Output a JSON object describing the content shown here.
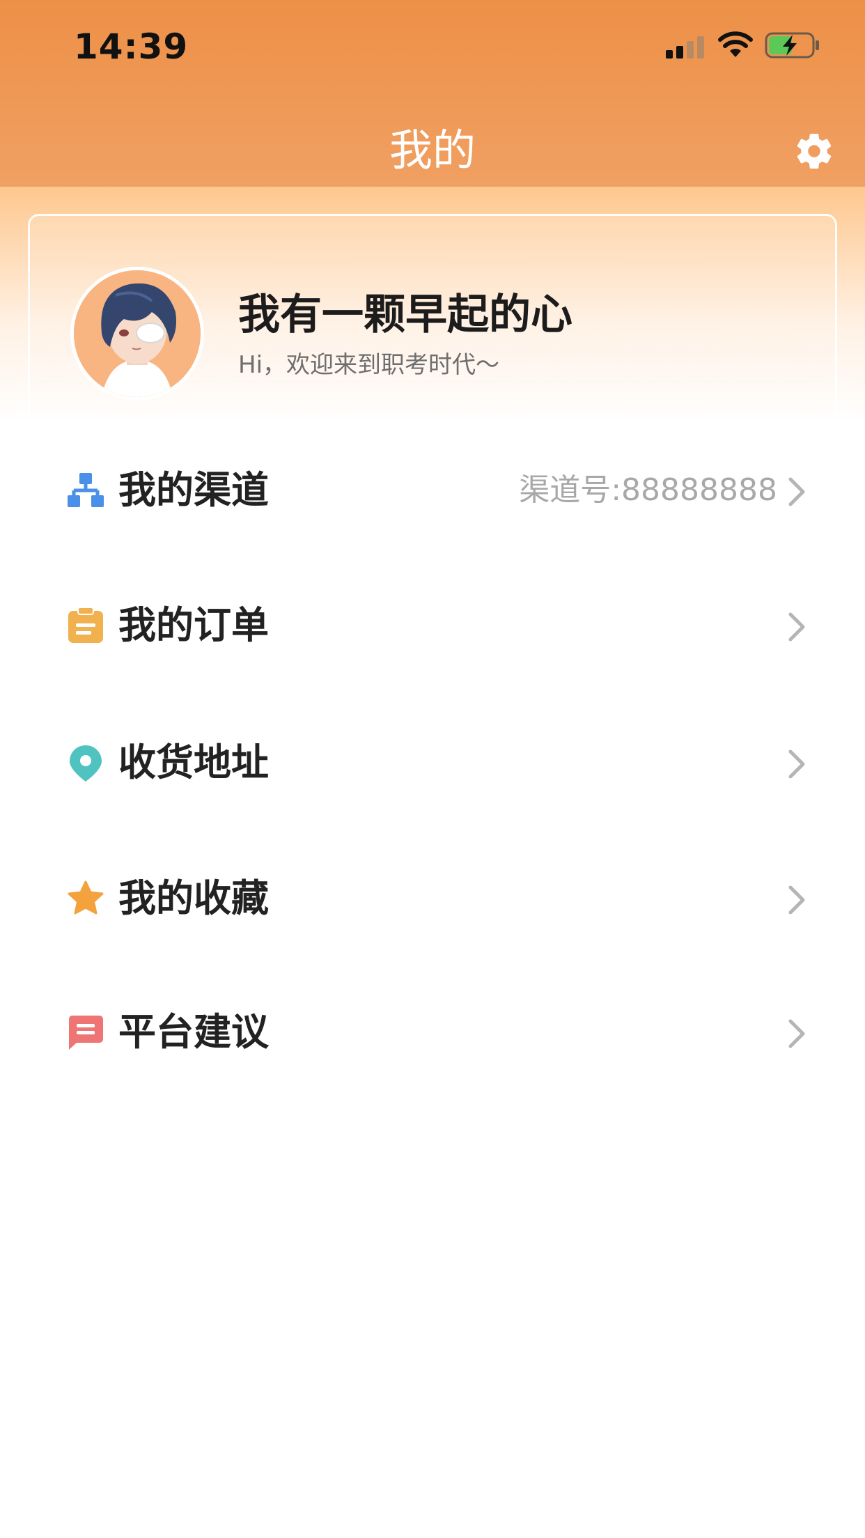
{
  "status_bar": {
    "time": "14:39",
    "battery_level": 0.55
  },
  "nav": {
    "title": "我的",
    "settings_icon": "gear-icon"
  },
  "profile": {
    "name": "我有一颗早起的心",
    "subtitle": "Hi，欢迎来到职考时代～"
  },
  "menu": [
    {
      "label": "我的渠道",
      "extra": "渠道号:88888888",
      "icon": "network-icon",
      "color": "#4a8fe8"
    },
    {
      "label": "我的订单",
      "extra": "",
      "icon": "clipboard-icon",
      "color": "#f0b14e"
    },
    {
      "label": "收货地址",
      "extra": "",
      "icon": "location-pin-icon",
      "color": "#50c3c1"
    },
    {
      "label": "我的收藏",
      "extra": "",
      "icon": "star-icon",
      "color": "#f3a23e"
    },
    {
      "label": "平台建议",
      "extra": "",
      "icon": "message-icon",
      "color": "#ef7474"
    }
  ],
  "colors": {
    "header_orange": "#ed9047",
    "chevron": "#b5b5b5"
  }
}
